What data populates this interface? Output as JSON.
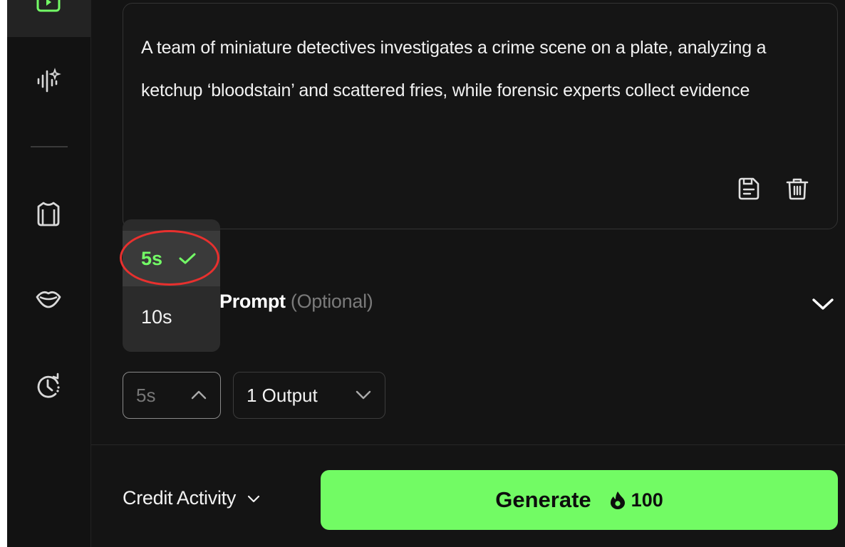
{
  "sidebar": {
    "items": [
      {
        "icon": "video-play-icon",
        "active": true
      },
      {
        "icon": "audio-sparkle-icon"
      },
      {
        "icon": "shirt-icon"
      },
      {
        "icon": "lips-icon"
      },
      {
        "icon": "history-clock-icon"
      }
    ]
  },
  "prompt": {
    "text": "A team of miniature detectives investigates a crime scene on a plate, analyzing a ketchup ‘bloodstain’ and scattered fries, while forensic experts collect evidence",
    "icons": [
      "save-icon",
      "trash-icon"
    ]
  },
  "negative_prompt": {
    "label_visible": "Prompt",
    "optional": "(Optional)"
  },
  "duration": {
    "value": "5s",
    "options": [
      {
        "label": "5s",
        "selected": true
      },
      {
        "label": "10s",
        "selected": false
      }
    ]
  },
  "outputs": {
    "value": "1 Output"
  },
  "footer": {
    "credit_label": "Credit Activity",
    "generate_label": "Generate",
    "cost": "100"
  },
  "colors": {
    "accent": "#72fb64",
    "annotation": "#e8302e",
    "background": "#141414"
  }
}
